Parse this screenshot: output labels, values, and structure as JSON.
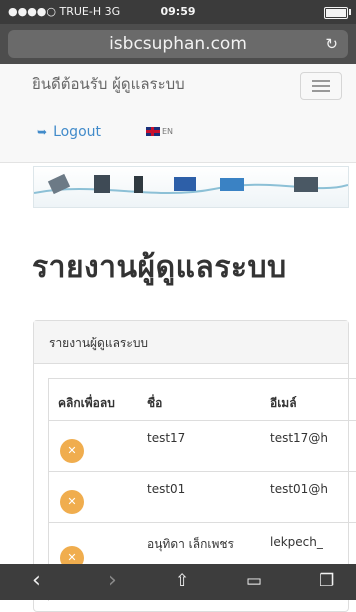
{
  "status_bar": {
    "carrier": "●●●●○ TRUE-H  3G",
    "time": "09:59"
  },
  "browser": {
    "url": "isbcsuphan.com"
  },
  "navbar": {
    "welcome": "ยินดีต้อนรับ ผู้ดูแลระบบ",
    "logout_label": "Logout",
    "language_label": "EN"
  },
  "page": {
    "title": "รายงานผู้ดูแลระบบ",
    "panel_heading": "รายงานผู้ดูแลระบบ"
  },
  "table": {
    "headers": [
      "คลิกเพื่อลบ",
      "ชื่อ",
      "อีเมล์"
    ],
    "rows": [
      {
        "name": "test17",
        "email": "test17@h"
      },
      {
        "name": "test01",
        "email": "test01@h"
      },
      {
        "name": "อนุทิดา เล็กเพชร",
        "email": "lekpech_"
      }
    ]
  },
  "icons": {
    "reload": "reload-icon",
    "logout": "sign-out-icon",
    "flag": "uk-flag-icon",
    "menu": "hamburger-icon",
    "delete": "close-icon",
    "back": "chevron-left-icon",
    "forward": "chevron-right-icon",
    "share": "share-icon",
    "bookmarks": "book-icon",
    "tabs": "tabs-icon"
  },
  "colors": {
    "link": "#428bca",
    "delete_button": "#f0ad4e",
    "browser_chrome": "#4d4d4d"
  }
}
